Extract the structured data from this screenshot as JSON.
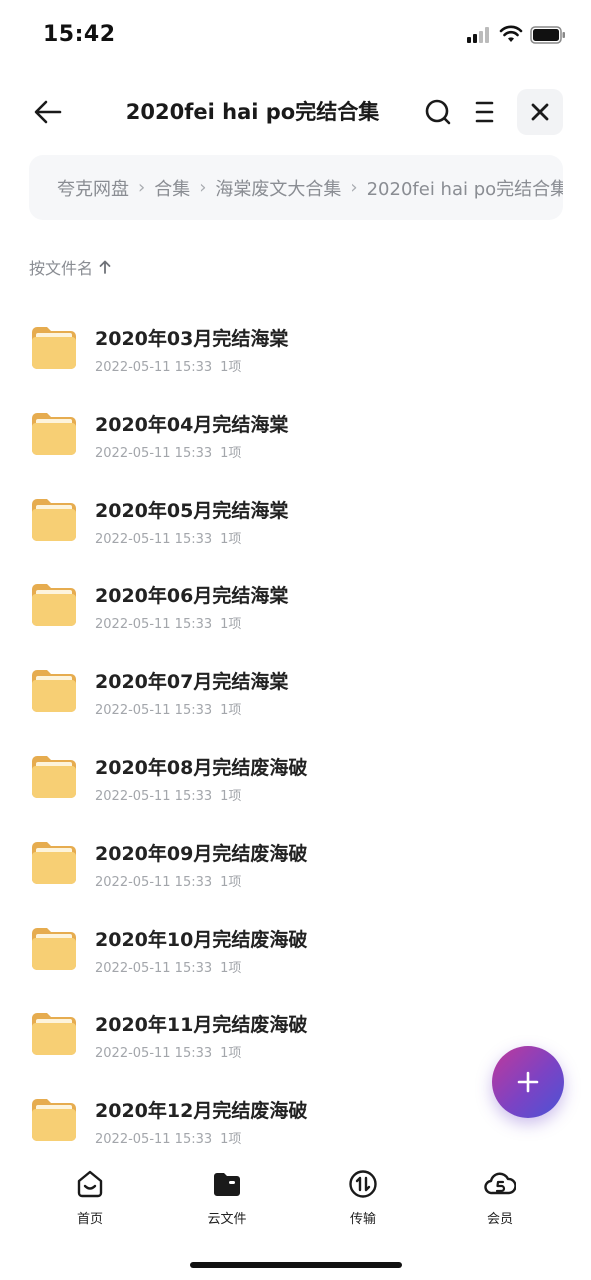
{
  "status_bar": {
    "time": "15:42"
  },
  "header": {
    "title": "2020fei hai po完结合集"
  },
  "breadcrumb": [
    "夸克网盘",
    "合集",
    "海棠废文大合集",
    "2020fei hai po完结合集"
  ],
  "sort": {
    "label": "按文件名"
  },
  "files": [
    {
      "name": "2020年03月完结海棠",
      "date": "2022-05-11 15:33",
      "count": "1项"
    },
    {
      "name": "2020年04月完结海棠",
      "date": "2022-05-11 15:33",
      "count": "1项"
    },
    {
      "name": "2020年05月完结海棠",
      "date": "2022-05-11 15:33",
      "count": "1项"
    },
    {
      "name": "2020年06月完结海棠",
      "date": "2022-05-11 15:33",
      "count": "1项"
    },
    {
      "name": "2020年07月完结海棠",
      "date": "2022-05-11 15:33",
      "count": "1项"
    },
    {
      "name": "2020年08月完结废海破",
      "date": "2022-05-11 15:33",
      "count": "1项"
    },
    {
      "name": "2020年09月完结废海破",
      "date": "2022-05-11 15:33",
      "count": "1项"
    },
    {
      "name": "2020年10月完结废海破",
      "date": "2022-05-11 15:33",
      "count": "1项"
    },
    {
      "name": "2020年11月完结废海破",
      "date": "2022-05-11 15:33",
      "count": "1项"
    },
    {
      "name": "2020年12月完结废海破",
      "date": "2022-05-11 15:33",
      "count": "1项"
    }
  ],
  "tabs": [
    {
      "label": "首页",
      "icon": "home-icon"
    },
    {
      "label": "云文件",
      "icon": "folder-icon"
    },
    {
      "label": "传输",
      "icon": "transfer-icon"
    },
    {
      "label": "会员",
      "icon": "membership-icon"
    }
  ],
  "colors": {
    "folder": "#f7cf74",
    "fab_start": "#c0399a",
    "fab_end": "#4a54d6",
    "breadcrumb_bg": "#f6f7f9"
  }
}
